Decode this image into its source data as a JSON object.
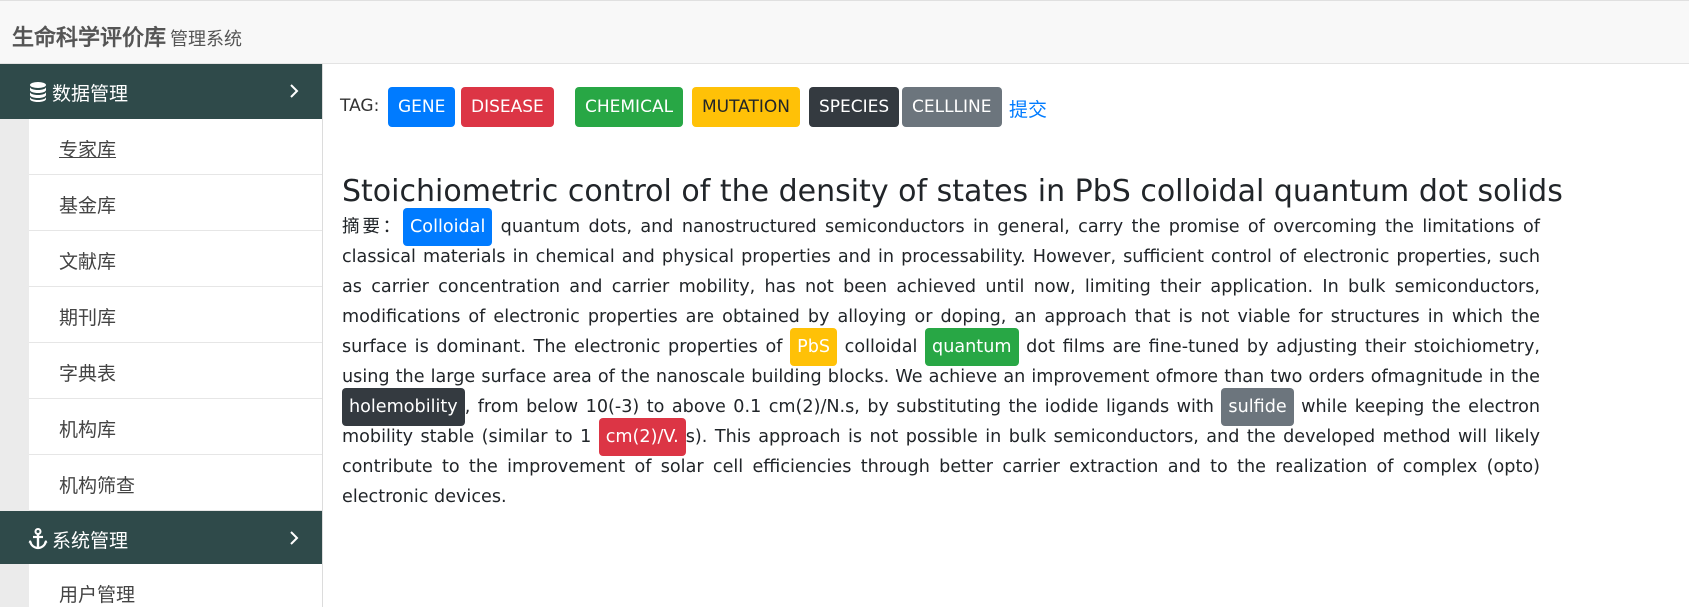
{
  "app": {
    "title": "生命科学评价库",
    "subtitle": "管理系统"
  },
  "colors": {
    "sidebar_header": "#2f4a4a",
    "gene": "#007bff",
    "disease": "#dc3545",
    "chemical": "#28a745",
    "mutation": "#ffc107",
    "species": "#343a40",
    "cellline": "#6c757d",
    "link": "#007bff"
  },
  "sidebar": {
    "sections": [
      {
        "label": "数据管理",
        "icon": "database-icon",
        "items": [
          {
            "label": "专家库"
          },
          {
            "label": "基金库"
          },
          {
            "label": "文献库"
          },
          {
            "label": "期刊库"
          },
          {
            "label": "字典表"
          },
          {
            "label": "机构库"
          },
          {
            "label": "机构筛查"
          }
        ]
      },
      {
        "label": "系统管理",
        "icon": "anchor-icon",
        "items": [
          {
            "label": "用户管理"
          }
        ]
      }
    ]
  },
  "tagbar": {
    "label": "TAG:",
    "tags": [
      {
        "label": "GENE"
      },
      {
        "label": "DISEASE"
      },
      {
        "label": "CHEMICAL"
      },
      {
        "label": "MUTATION"
      },
      {
        "label": "SPECIES"
      },
      {
        "label": "CELLLINE"
      }
    ],
    "submit": "提交"
  },
  "article": {
    "title": "Stoichiometric control of the density of states in PbS colloidal quantum dot solids",
    "abstract_label": "摘要：",
    "segments": [
      {
        "text": "Colloidal",
        "tag": "gene"
      },
      {
        "text": " quantum dots, and nanostructured semiconductors in general, carry the promise of overcoming the limitations of classical materials in chemical and physical properties and in processability. However, sufficient control of electronic properties, such as carrier concentration and carrier mobility, has not been achieved until now, limiting their application. In bulk semiconductors, modifications of electronic properties are obtained by alloying or doping, an approach that is not viable for structures in which the surface is dominant. The electronic properties of "
      },
      {
        "text": "PbS",
        "tag": "mutation"
      },
      {
        "text": " colloidal "
      },
      {
        "text": "quantum",
        "tag": "chemical"
      },
      {
        "text": " dot films are fine-tuned by adjusting their stoichiometry, using the large surface area of the nanoscale building blocks. We achieve an improvement ofmore than two orders ofmagnitude in the "
      },
      {
        "text": "holemobility",
        "tag": "species"
      },
      {
        "text": ", from below 10(-3) to above 0.1 cm(2)/N.s, by substituting the iodide ligands with "
      },
      {
        "text": "sulfide",
        "tag": "cellline"
      },
      {
        "text": " while keeping the electron mobility stable (similar to 1 "
      },
      {
        "text": "cm(2)/V.",
        "tag": "disease"
      },
      {
        "text": "s). This approach is not possible in bulk semiconductors, and the developed method will likely contribute to the improvement of solar cell efficiencies through better carrier extraction and to the realization of complex (opto) electronic devices."
      }
    ]
  }
}
